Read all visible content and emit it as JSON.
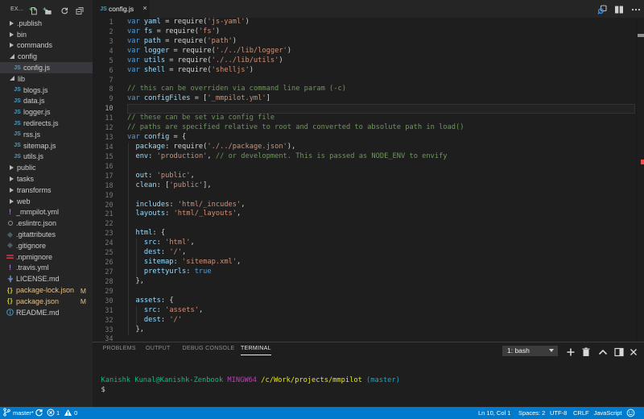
{
  "colors": {
    "accent": "#007acc",
    "editor_bg": "#1e1e1e",
    "sidebar_bg": "#252526",
    "selection_bg": "#37373d",
    "git_modified": "#e2c08d",
    "error_mark": "#f14c4c",
    "keyword": "#569cd6",
    "string": "#ce9178",
    "comment": "#6a9955",
    "identifier": "#9cdcfe"
  },
  "sidebar": {
    "title": "EX...",
    "actions": [
      {
        "name": "new-file",
        "icon": "new-file-icon"
      },
      {
        "name": "new-folder",
        "icon": "new-folder-icon"
      },
      {
        "name": "refresh",
        "icon": "refresh-icon"
      },
      {
        "name": "collapse-all",
        "icon": "collapse-all-icon"
      }
    ],
    "tree": [
      {
        "kind": "folder",
        "label": ".publish",
        "level": 0,
        "expanded": false
      },
      {
        "kind": "folder",
        "label": "bin",
        "level": 0,
        "expanded": false
      },
      {
        "kind": "folder",
        "label": "commands",
        "level": 0,
        "expanded": false
      },
      {
        "kind": "folder",
        "label": "config",
        "level": 0,
        "expanded": true
      },
      {
        "kind": "file",
        "label": "config.js",
        "level": 1,
        "icon": "js",
        "selected": true
      },
      {
        "kind": "folder",
        "label": "lib",
        "level": 0,
        "expanded": true
      },
      {
        "kind": "file",
        "label": "blogs.js",
        "level": 1,
        "icon": "js"
      },
      {
        "kind": "file",
        "label": "data.js",
        "level": 1,
        "icon": "js"
      },
      {
        "kind": "file",
        "label": "logger.js",
        "level": 1,
        "icon": "js"
      },
      {
        "kind": "file",
        "label": "redirects.js",
        "level": 1,
        "icon": "js"
      },
      {
        "kind": "file",
        "label": "rss.js",
        "level": 1,
        "icon": "js"
      },
      {
        "kind": "file",
        "label": "sitemap.js",
        "level": 1,
        "icon": "js"
      },
      {
        "kind": "file",
        "label": "utils.js",
        "level": 1,
        "icon": "js"
      },
      {
        "kind": "folder",
        "label": "public",
        "level": 0,
        "expanded": false
      },
      {
        "kind": "folder",
        "label": "tasks",
        "level": 0,
        "expanded": false
      },
      {
        "kind": "folder",
        "label": "transforms",
        "level": 0,
        "expanded": false
      },
      {
        "kind": "folder",
        "label": "web",
        "level": 0,
        "expanded": false
      },
      {
        "kind": "file",
        "label": "_mmpilot.yml",
        "level": 0,
        "icon": "yaml"
      },
      {
        "kind": "file",
        "label": ".eslintrc.json",
        "level": 0,
        "icon": "eslint"
      },
      {
        "kind": "file",
        "label": ".gitattributes",
        "level": 0,
        "icon": "git"
      },
      {
        "kind": "file",
        "label": ".gitignore",
        "level": 0,
        "icon": "git"
      },
      {
        "kind": "file",
        "label": ".npmignore",
        "level": 0,
        "icon": "npm"
      },
      {
        "kind": "file",
        "label": ".travis.yml",
        "level": 0,
        "icon": "yaml"
      },
      {
        "kind": "file",
        "label": "LICENSE.md",
        "level": 0,
        "icon": "license"
      },
      {
        "kind": "file",
        "label": "package-lock.json",
        "level": 0,
        "icon": "json",
        "badge": "M",
        "modified": true
      },
      {
        "kind": "file",
        "label": "package.json",
        "level": 0,
        "icon": "json",
        "badge": "M",
        "modified": true
      },
      {
        "kind": "file",
        "label": "README.md",
        "level": 0,
        "icon": "info"
      }
    ]
  },
  "tabbar": {
    "tab": {
      "label": "config.js",
      "icon": "js",
      "close": "×",
      "active": true
    },
    "actions": [
      {
        "name": "open-changes",
        "icon": "open-changes-icon"
      },
      {
        "name": "split-editor",
        "icon": "split-editor-icon"
      },
      {
        "name": "more-actions",
        "icon": "ellipsis-icon"
      }
    ]
  },
  "editor": {
    "active_line": 10,
    "ruler_marks": [
      {
        "line": 2,
        "color": "#8f8f8f"
      },
      {
        "line": 15,
        "color": "#f14c4c"
      }
    ],
    "lines": [
      {
        "n": 1,
        "tokens": [
          [
            "kw",
            "var "
          ],
          [
            "id",
            "yaml"
          ],
          [
            "d",
            " = require("
          ],
          [
            "str",
            "'js-yaml'"
          ],
          [
            "d",
            ")"
          ]
        ]
      },
      {
        "n": 2,
        "tokens": [
          [
            "kw",
            "var "
          ],
          [
            "id",
            "fs"
          ],
          [
            "d",
            " = require("
          ],
          [
            "str",
            "'fs'"
          ],
          [
            "d",
            ")"
          ]
        ]
      },
      {
        "n": 3,
        "tokens": [
          [
            "kw",
            "var "
          ],
          [
            "id",
            "path"
          ],
          [
            "d",
            " = require("
          ],
          [
            "str",
            "'path'"
          ],
          [
            "d",
            ")"
          ]
        ]
      },
      {
        "n": 4,
        "tokens": [
          [
            "kw",
            "var "
          ],
          [
            "id",
            "logger"
          ],
          [
            "d",
            " = require("
          ],
          [
            "str",
            "'./../lib/logger'"
          ],
          [
            "d",
            ")"
          ]
        ]
      },
      {
        "n": 5,
        "tokens": [
          [
            "kw",
            "var "
          ],
          [
            "id",
            "utils"
          ],
          [
            "d",
            " = require("
          ],
          [
            "str",
            "'./../lib/utils'"
          ],
          [
            "d",
            ")"
          ]
        ]
      },
      {
        "n": 6,
        "tokens": [
          [
            "kw",
            "var "
          ],
          [
            "id",
            "shell"
          ],
          [
            "d",
            " = require("
          ],
          [
            "str",
            "'shelljs'"
          ],
          [
            "d",
            ")"
          ]
        ]
      },
      {
        "n": 7,
        "tokens": []
      },
      {
        "n": 8,
        "tokens": [
          [
            "com",
            "// this can be overriden via command line param (-c)"
          ]
        ]
      },
      {
        "n": 9,
        "tokens": [
          [
            "kw",
            "var "
          ],
          [
            "id",
            "configFiles"
          ],
          [
            "d",
            " = ["
          ],
          [
            "str",
            "'_mmpilot.yml'"
          ],
          [
            "d",
            "]"
          ]
        ]
      },
      {
        "n": 10,
        "tokens": []
      },
      {
        "n": 11,
        "tokens": [
          [
            "com",
            "// these can be set via config file"
          ]
        ]
      },
      {
        "n": 12,
        "tokens": [
          [
            "com",
            "// paths are specified relative to root and converted to absolute path in load()"
          ]
        ]
      },
      {
        "n": 13,
        "tokens": [
          [
            "kw",
            "var "
          ],
          [
            "id",
            "config"
          ],
          [
            "d",
            " = {"
          ]
        ]
      },
      {
        "n": 14,
        "tokens": [
          [
            "d",
            "  "
          ],
          [
            "id",
            "package"
          ],
          [
            "d",
            ": require("
          ],
          [
            "str",
            "'./../package.json'"
          ],
          [
            "d",
            "),"
          ]
        ]
      },
      {
        "n": 15,
        "tokens": [
          [
            "d",
            "  "
          ],
          [
            "id",
            "env"
          ],
          [
            "d",
            ": "
          ],
          [
            "str",
            "'production'"
          ],
          [
            "d",
            ", "
          ],
          [
            "com",
            "// or development. This is passed as NODE_ENV to envify"
          ]
        ]
      },
      {
        "n": 16,
        "tokens": []
      },
      {
        "n": 17,
        "tokens": [
          [
            "d",
            "  "
          ],
          [
            "id",
            "out"
          ],
          [
            "d",
            ": "
          ],
          [
            "str",
            "'public'"
          ],
          [
            "d",
            ","
          ]
        ]
      },
      {
        "n": 18,
        "tokens": [
          [
            "d",
            "  "
          ],
          [
            "id",
            "clean"
          ],
          [
            "d",
            ": ["
          ],
          [
            "str",
            "'public'"
          ],
          [
            "d",
            "],"
          ]
        ]
      },
      {
        "n": 19,
        "tokens": []
      },
      {
        "n": 20,
        "tokens": [
          [
            "d",
            "  "
          ],
          [
            "id",
            "includes"
          ],
          [
            "d",
            ": "
          ],
          [
            "str",
            "'html/_incudes'"
          ],
          [
            "d",
            ","
          ]
        ]
      },
      {
        "n": 21,
        "tokens": [
          [
            "d",
            "  "
          ],
          [
            "id",
            "layouts"
          ],
          [
            "d",
            ": "
          ],
          [
            "str",
            "'html/_layouts'"
          ],
          [
            "d",
            ","
          ]
        ]
      },
      {
        "n": 22,
        "tokens": []
      },
      {
        "n": 23,
        "tokens": [
          [
            "d",
            "  "
          ],
          [
            "id",
            "html"
          ],
          [
            "d",
            ": {"
          ]
        ]
      },
      {
        "n": 24,
        "tokens": [
          [
            "d",
            "    "
          ],
          [
            "id",
            "src"
          ],
          [
            "d",
            ": "
          ],
          [
            "str",
            "'html'"
          ],
          [
            "d",
            ","
          ]
        ]
      },
      {
        "n": 25,
        "tokens": [
          [
            "d",
            "    "
          ],
          [
            "id",
            "dest"
          ],
          [
            "d",
            ": "
          ],
          [
            "str",
            "'/'"
          ],
          [
            "d",
            ","
          ]
        ]
      },
      {
        "n": 26,
        "tokens": [
          [
            "d",
            "    "
          ],
          [
            "id",
            "sitemap"
          ],
          [
            "d",
            ": "
          ],
          [
            "str",
            "'sitemap.xml'"
          ],
          [
            "d",
            ","
          ]
        ]
      },
      {
        "n": 27,
        "tokens": [
          [
            "d",
            "    "
          ],
          [
            "id",
            "prettyurls"
          ],
          [
            "d",
            ": "
          ],
          [
            "kw",
            "true"
          ]
        ]
      },
      {
        "n": 28,
        "tokens": [
          [
            "d",
            "  },"
          ]
        ]
      },
      {
        "n": 29,
        "tokens": []
      },
      {
        "n": 30,
        "tokens": [
          [
            "d",
            "  "
          ],
          [
            "id",
            "assets"
          ],
          [
            "d",
            ": {"
          ]
        ]
      },
      {
        "n": 31,
        "tokens": [
          [
            "d",
            "    "
          ],
          [
            "id",
            "src"
          ],
          [
            "d",
            ": "
          ],
          [
            "str",
            "'assets'"
          ],
          [
            "d",
            ","
          ]
        ]
      },
      {
        "n": 32,
        "tokens": [
          [
            "d",
            "    "
          ],
          [
            "id",
            "dest"
          ],
          [
            "d",
            ": "
          ],
          [
            "str",
            "'/'"
          ]
        ]
      },
      {
        "n": 33,
        "tokens": [
          [
            "d",
            "  },"
          ]
        ]
      },
      {
        "n": 34,
        "tokens": []
      }
    ]
  },
  "panel": {
    "tabs": [
      {
        "label": "PROBLEMS",
        "active": false
      },
      {
        "label": "OUTPUT",
        "active": false
      },
      {
        "label": "DEBUG CONSOLE",
        "active": false
      },
      {
        "label": "TERMINAL",
        "active": true
      }
    ],
    "terminal_select": "1: bash",
    "actions": [
      {
        "name": "new-terminal",
        "icon": "plus-icon"
      },
      {
        "name": "kill-terminal",
        "icon": "trash-icon"
      },
      {
        "name": "maximize-panel",
        "icon": "chevron-up-icon"
      },
      {
        "name": "move-panel",
        "icon": "split-box-icon"
      },
      {
        "name": "close-panel",
        "icon": "close-icon"
      }
    ],
    "terminal_lines": [
      {
        "spans": [
          [
            "green",
            "Kanishk Kunal@Kanishk-Zenbook "
          ],
          [
            "magenta",
            "MINGW64 "
          ],
          [
            "yellow",
            "/c/Work/projects/mmpilot "
          ],
          [
            "cyan",
            "(master)"
          ]
        ]
      },
      {
        "spans": [
          [
            "fg",
            "$"
          ]
        ]
      }
    ]
  },
  "statusbar": {
    "branch": "master*",
    "errors": "1",
    "warnings": "0",
    "right_items": [
      "Ln 10, Col 1",
      "Spaces: 2",
      "UTF-8",
      "CRLF",
      "JavaScript"
    ]
  }
}
